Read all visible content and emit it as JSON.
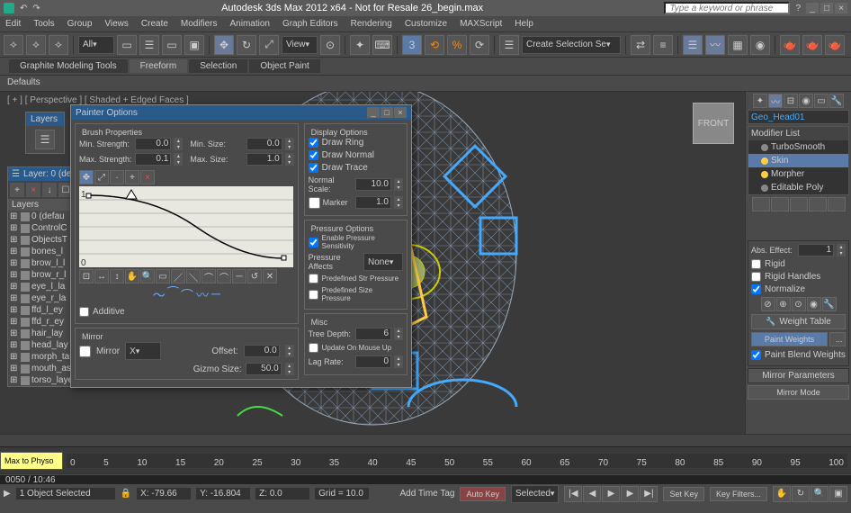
{
  "titlebar": {
    "title": "Autodesk 3ds Max  2012 x64 - Not for Resale   26_begin.max",
    "search_placeholder": "Type a keyword or phrase"
  },
  "menus": [
    "Edit",
    "Tools",
    "Group",
    "Views",
    "Create",
    "Modifiers",
    "Animation",
    "Graph Editors",
    "Rendering",
    "Customize",
    "MAXScript",
    "Help"
  ],
  "toolbar": {
    "dropdown_all": "All",
    "dropdown_view": "View",
    "dropdown_selset": "Create Selection Se"
  },
  "ribbon": {
    "tabs": [
      "Graphite Modeling Tools",
      "Freeform",
      "Selection",
      "Object Paint"
    ],
    "active": 1
  },
  "defaults_label": "Defaults",
  "viewport": {
    "label": "[ + ] [ Perspective ] [ Shaded + Edged Faces ]",
    "cube_label": "FRONT"
  },
  "right_panel": {
    "object_name": "Geo_Head01",
    "modifier_list_label": "Modifier List",
    "modifiers": [
      {
        "name": "TurboSmooth",
        "on": false,
        "sel": false
      },
      {
        "name": "Skin",
        "on": true,
        "sel": true
      },
      {
        "name": "Morpher",
        "on": true,
        "sel": false
      },
      {
        "name": "Editable Poly",
        "on": false,
        "sel": false
      }
    ],
    "abs_effect_label": "Abs. Effect:",
    "abs_effect_value": "1",
    "rigid": "Rigid",
    "rigid_handles": "Rigid Handles",
    "normalize": "Normalize",
    "weight_table": "Weight Table",
    "paint_weights": "Paint Weights",
    "paint_blend": "Paint Blend Weights",
    "mirror_params": "Mirror Parameters",
    "mirror_mode": "Mirror Mode"
  },
  "painter_dialog": {
    "title": "Painter Options",
    "brush_props": "Brush Properties",
    "min_strength": "Min. Strength:",
    "min_strength_v": "0.0",
    "max_strength": "Max. Strength:",
    "max_strength_v": "0.1",
    "min_size": "Min. Size:",
    "min_size_v": "0.0",
    "max_size": "Max. Size:",
    "max_size_v": "1.0",
    "additive": "Additive",
    "mirror_group": "Mirror",
    "mirror": "Mirror",
    "mirror_axis": "X",
    "offset": "Offset:",
    "offset_v": "0.0",
    "gizmo": "Gizmo Size:",
    "gizmo_v": "50.0",
    "display_opts": "Display Options",
    "draw_ring": "Draw Ring",
    "draw_normal": "Draw Normal",
    "draw_trace": "Draw Trace",
    "normal_scale": "Normal Scale:",
    "normal_scale_v": "10.0",
    "marker": "Marker",
    "marker_v": "1.0",
    "pressure_opts": "Pressure Options",
    "enable_pressure": "Enable Pressure Sensitivity",
    "pressure_affects": "Pressure Affects",
    "pressure_affects_v": "None",
    "pre_str": "Predefined Str Pressure",
    "pre_size": "Predefined Size Pressure",
    "misc": "Misc",
    "tree_depth": "Tree Depth:",
    "tree_depth_v": "6",
    "update_mouse": "Update On Mouse Up",
    "lag_rate": "Lag Rate:",
    "lag_rate_v": "0"
  },
  "layers_toolbar": {
    "title": "Layers"
  },
  "layers_panel": {
    "title": "Layer: 0 (de",
    "tab": "Layers",
    "items": [
      "0 (defau",
      "ControlC",
      "ObjectsT",
      "bones_l",
      "brow_l_l",
      "brow_r_l",
      "eye_l_la",
      "eye_r_la",
      "ffd_l_ey",
      "ffd_r_ey",
      "hair_lay",
      "head_lay",
      "morph_targets_laye",
      "mouth_assets_layer",
      "torso_layer"
    ]
  },
  "timeline": {
    "ticks": [
      "0",
      "5",
      "10",
      "15",
      "20",
      "25",
      "30",
      "35",
      "40",
      "45",
      "50",
      "55",
      "60",
      "65",
      "70",
      "75",
      "80",
      "85",
      "90",
      "95",
      "100"
    ]
  },
  "status": {
    "max_to_physx": "Max to Physo",
    "selected": "1 Object Selected",
    "x": "X: -79.66",
    "y": "Y: -16.804",
    "z": "Z: 0.0",
    "grid": "Grid = 10.0",
    "add_time_tag": "Add Time Tag",
    "auto_key": "Auto Key",
    "selected_drop": "Selected",
    "set_key": "Set Key",
    "key_filters": "Key Filters..."
  },
  "video": {
    "time": "0050 / 10:46"
  }
}
